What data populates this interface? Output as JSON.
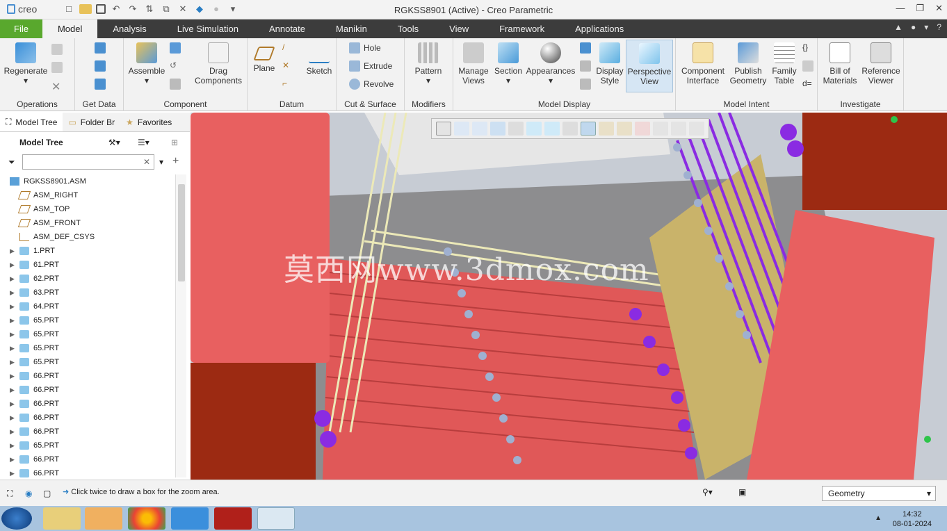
{
  "window": {
    "app_logo": "creo",
    "title": "RGKSS8901 (Active) - Creo Parametric",
    "controls": [
      "minimize-icon",
      "restore-icon",
      "close-icon"
    ]
  },
  "ribbon_tabs": [
    "File",
    "Model",
    "Analysis",
    "Live Simulation",
    "Annotate",
    "Manikin",
    "Tools",
    "View",
    "Framework",
    "Applications"
  ],
  "active_tab": "Model",
  "groups": {
    "operations": {
      "label": "Operations",
      "regenerate": "Regenerate"
    },
    "getdata": {
      "label": "Get Data"
    },
    "component": {
      "label": "Component",
      "assemble": "Assemble",
      "drag": "Drag Components"
    },
    "datum": {
      "label": "Datum",
      "plane": "Plane",
      "sketch": "Sketch"
    },
    "cutsurface": {
      "label": "Cut & Surface",
      "hole": "Hole",
      "extrude": "Extrude",
      "revolve": "Revolve"
    },
    "modifiers": {
      "label": "Modifiers",
      "pattern": "Pattern"
    },
    "modeldisplay": {
      "label": "Model Display",
      "manage_views": "Manage Views",
      "section": "Section",
      "appearances": "Appearances",
      "display_style": "Display Style",
      "perspective": "Perspective View"
    },
    "modelintent": {
      "label": "Model Intent",
      "component_interface": "Component Interface",
      "publish_geometry": "Publish Geometry",
      "family_table": "Family Table"
    },
    "investigate": {
      "label": "Investigate",
      "bom": "Bill of Materials",
      "reference_viewer": "Reference Viewer"
    }
  },
  "navigator": {
    "tabs": [
      "Model Tree",
      "Folder Br",
      "Favorites"
    ],
    "tree_title": "Model Tree",
    "filter_placeholder": "",
    "items": [
      {
        "label": "RGKSS8901.ASM",
        "kind": "asm",
        "expandable": false
      },
      {
        "label": "ASM_RIGHT",
        "kind": "plane",
        "expandable": false
      },
      {
        "label": "ASM_TOP",
        "kind": "plane",
        "expandable": false
      },
      {
        "label": "ASM_FRONT",
        "kind": "plane",
        "expandable": false
      },
      {
        "label": "ASM_DEF_CSYS",
        "kind": "csys",
        "expandable": false
      },
      {
        "label": "1.PRT",
        "kind": "part",
        "expandable": true
      },
      {
        "label": "61.PRT",
        "kind": "part",
        "expandable": true
      },
      {
        "label": "62.PRT",
        "kind": "part",
        "expandable": true
      },
      {
        "label": "63.PRT",
        "kind": "part",
        "expandable": true
      },
      {
        "label": "64.PRT",
        "kind": "part",
        "expandable": true
      },
      {
        "label": "65.PRT",
        "kind": "part",
        "expandable": true
      },
      {
        "label": "65.PRT",
        "kind": "part",
        "expandable": true
      },
      {
        "label": "65.PRT",
        "kind": "part",
        "expandable": true
      },
      {
        "label": "65.PRT",
        "kind": "part",
        "expandable": true
      },
      {
        "label": "66.PRT",
        "kind": "part",
        "expandable": true
      },
      {
        "label": "66.PRT",
        "kind": "part",
        "expandable": true
      },
      {
        "label": "66.PRT",
        "kind": "part",
        "expandable": true
      },
      {
        "label": "66.PRT",
        "kind": "part",
        "expandable": true
      },
      {
        "label": "66.PRT",
        "kind": "part",
        "expandable": true
      },
      {
        "label": "65.PRT",
        "kind": "part",
        "expandable": true
      },
      {
        "label": "66.PRT",
        "kind": "part",
        "expandable": true
      },
      {
        "label": "66.PRT",
        "kind": "part",
        "expandable": true
      }
    ]
  },
  "viewport": {
    "watermark": "莫西网www.3dmox.com"
  },
  "status": {
    "message": "Click twice to draw a box for the zoom area.",
    "filter": "Geometry"
  },
  "taskbar": {
    "time": "14:32",
    "date": "08-01-2024"
  },
  "colors": {
    "ribbon_dark": "#3c3c3c",
    "file_green": "#59a82d",
    "part_red": "#e85a5a",
    "part_dark": "#a02a10",
    "purple": "#8a2be2"
  }
}
